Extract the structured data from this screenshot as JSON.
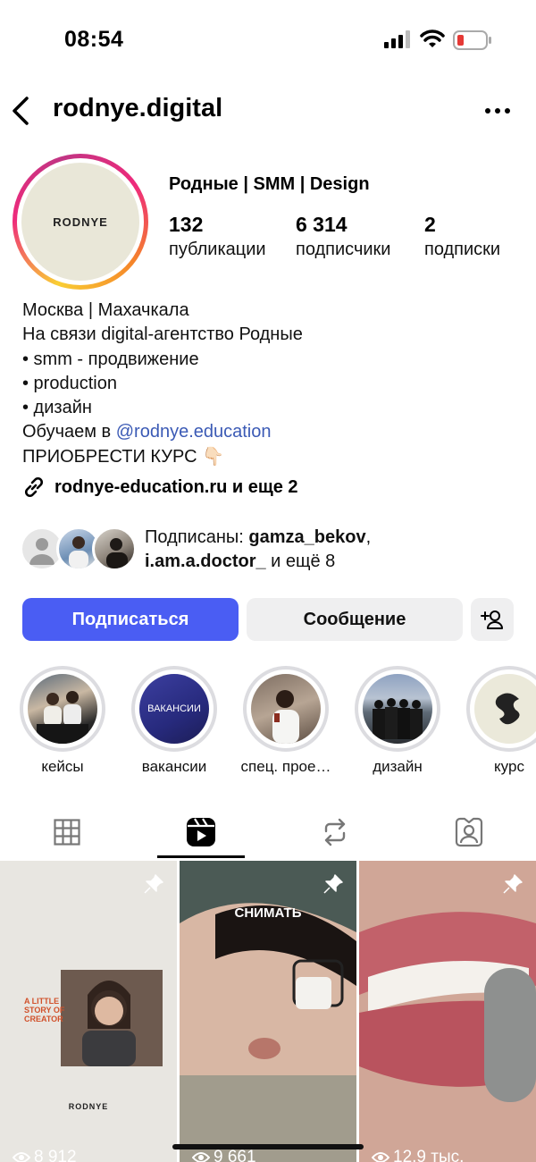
{
  "status_bar": {
    "time": "08:54"
  },
  "header": {
    "username": "rodnye.digital"
  },
  "profile": {
    "avatar_text": "RODNYE",
    "display_name": "Родные | SMM | Design",
    "stats": [
      {
        "value": "132",
        "label": "публикации"
      },
      {
        "value": "6 314",
        "label": "подписчики"
      },
      {
        "value": "2",
        "label": "подписки"
      }
    ],
    "bio": {
      "line1": "Москва  |  Махачкала",
      "line2": "На связи digital-агентство Родные",
      "line3": "• smm - продвижение",
      "line4": "• production",
      "line5": "• дизайн",
      "line6_prefix": "Обучаем в ",
      "line6_mention": "@rodnye.education",
      "line7": "ПРИОБРЕСТИ КУРС 👇🏻"
    },
    "link": "rodnye-education.ru и еще 2",
    "followed_by": {
      "prefix": "Подписаны: ",
      "user1": "gamza_bekov",
      "sep": ",",
      "user2": "i.am.a.doctor_",
      "suffix": " и ещё 8"
    }
  },
  "actions": {
    "follow": "Подписаться",
    "message": "Сообщение"
  },
  "highlights": [
    {
      "label": "кейсы",
      "overlay": ""
    },
    {
      "label": "вакансии",
      "overlay": "ВАКАНСИИ"
    },
    {
      "label": "спец. прое…",
      "overlay": ""
    },
    {
      "label": "дизайн",
      "overlay": ""
    },
    {
      "label": "курс",
      "overlay": ""
    }
  ],
  "tabs": [
    "grid-tab",
    "reels-tab",
    "reposts-tab",
    "tagged-tab"
  ],
  "reels": [
    {
      "views": "8 912",
      "title": "A LITTLE STORY OF CREATOR",
      "brand": "RODNYE"
    },
    {
      "views": "9 661",
      "overlay": "СНИМАТЬ"
    },
    {
      "views": "12,9 тыс."
    }
  ],
  "colors": {
    "accent": "#4a5df3",
    "mention": "#3b5ab5",
    "button_gray": "#efeff0"
  }
}
